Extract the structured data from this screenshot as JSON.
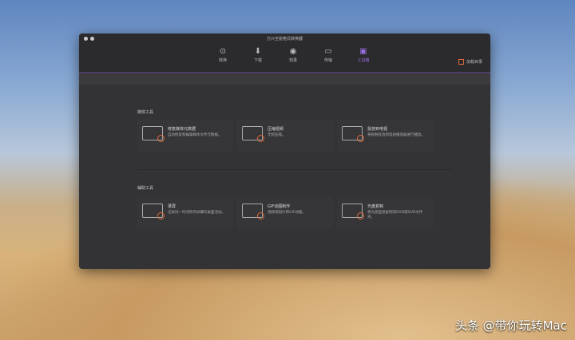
{
  "window": {
    "title": "万兴全能格式转换器"
  },
  "tabs": [
    {
      "label": "转换",
      "icon": "play-circle-icon"
    },
    {
      "label": "下载",
      "icon": "download-icon"
    },
    {
      "label": "刻录",
      "icon": "disc-icon"
    },
    {
      "label": "传输",
      "icon": "transfer-icon"
    },
    {
      "label": "工具箱",
      "icon": "toolbox-icon"
    }
  ],
  "active_tab": "工具箱",
  "output_dir": "加载目录",
  "sections": [
    {
      "title": "媒体工具",
      "tools": [
        {
          "name": "修复媒体元数据",
          "desc": "自动修复和编辑媒体文件元数据。"
        },
        {
          "name": "压缩视频",
          "desc": "无损压缩。"
        },
        {
          "name": "投放到电视",
          "desc": "将视频投放到电视播放器进行播放。"
        }
      ]
    },
    {
      "title": "辅助工具",
      "tools": [
        {
          "name": "录屏",
          "desc": "记录同一时间所有屏幕的桌面活动。"
        },
        {
          "name": "GIF动图制作",
          "desc": "视频或图片转GIF动图。"
        },
        {
          "name": "光盘复制",
          "desc": "将光盘直接复制到DVD或DVD文件夹。"
        }
      ]
    }
  ],
  "watermark": "头条 @带你玩转Mac"
}
